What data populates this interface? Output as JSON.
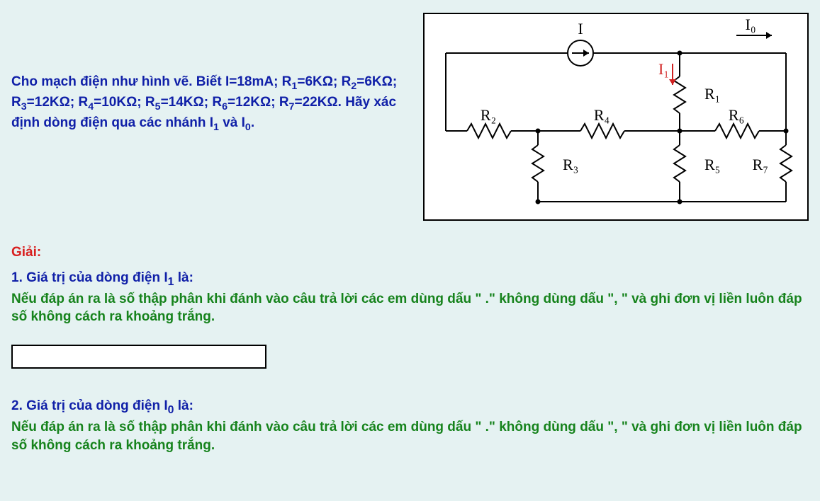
{
  "problem": {
    "text_html": "Cho mạch điện như hình vẽ. Biết  I=18mA; R<sub>1</sub>=6KΩ; R<sub>2</sub>=6KΩ; R<sub>3</sub>=12KΩ; R<sub>4</sub>=10KΩ; R<sub>5</sub>=14KΩ; R<sub>6</sub>=12KΩ; R<sub>7</sub>=22KΩ. Hãy xác định dòng điện qua các nhánh I<sub>1</sub> và I<sub>0</sub>."
  },
  "circuit": {
    "source_label": "I",
    "output_current_label": "I₀",
    "branch_current_label": "I₁",
    "components": {
      "R1": "R₁",
      "R2": "R₂",
      "R3": "R₃",
      "R4": "R₄",
      "R5": "R₅",
      "R6": "R₆",
      "R7": "R₇"
    }
  },
  "solution": {
    "heading": "Giải:",
    "q1": {
      "prompt_html": "1. Giá trị  của dòng điện I<sub>1</sub>  là:",
      "hint": "Nếu đáp án ra là số thập phân khi đánh vào câu trả lời các em dùng dấu \" .\" không dùng dấu  \", \" và ghi đơn vị liền luôn đáp số không cách ra khoảng trắng.",
      "value": ""
    },
    "q2": {
      "prompt_html": "2. Giá trị  của dòng điện I<sub>0</sub> là:",
      "hint": "Nếu đáp án ra là số thập phân khi đánh vào câu trả lời các em dùng dấu \" .\" không dùng dấu  \", \" và ghi đơn vị liền luôn đáp số không cách ra khoảng trắng."
    }
  }
}
